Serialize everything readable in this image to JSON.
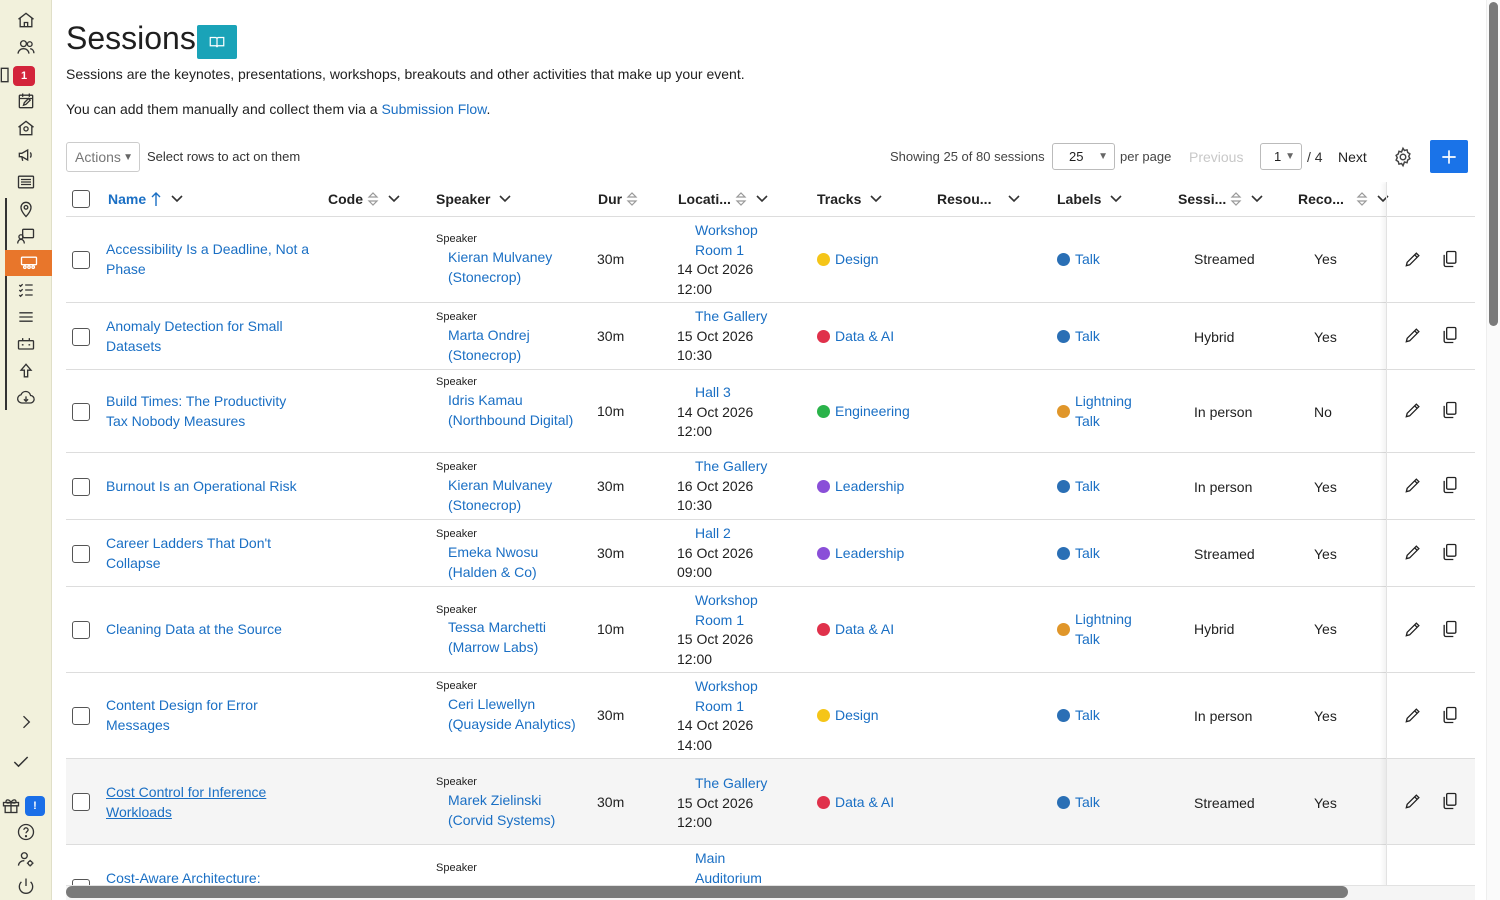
{
  "page": {
    "title": "Sessions",
    "description": "Sessions are the keynotes, presentations, workshops, breakouts and other activities that make up your event.",
    "add_text": "You can add them manually and collect them via a ",
    "add_link": "Submission Flow",
    "add_suffix": "."
  },
  "sidebar": {
    "badge_notifications": "1",
    "badge_updates": "!"
  },
  "toolbar": {
    "actions_label": "Actions",
    "select_hint": "Select rows to act on them",
    "showing": "Showing 25 of 80 sessions",
    "per_page_value": "25",
    "per_page_label": "per page",
    "previous": "Previous",
    "page_value": "1",
    "page_total": "/ 4",
    "next": "Next"
  },
  "columns": {
    "name": "Name",
    "code": "Code",
    "speaker": "Speaker",
    "duration": "Dur",
    "location": "Locati...",
    "tracks": "Tracks",
    "resources": "Resou...",
    "labels": "Labels",
    "session_type": "Sessi...",
    "recorded": "Reco..."
  },
  "colors": {
    "accent": "#1a6fc4",
    "sidebar_active": "#e8762b",
    "design": "#f5c518",
    "data_ai": "#e0314b",
    "engineering": "#2ab34a",
    "leadership": "#8a4fd8",
    "talk": "#2a6fb5",
    "lightning": "#e0962a"
  },
  "rows": [
    {
      "name": "Accessibility Is a Deadline, Not a Phase",
      "speaker_label": "Speaker",
      "speaker": "Kieran Mulvaney (Stonecrop)",
      "duration": "30m",
      "place": "Workshop Room 1",
      "date": "14 Oct 2026",
      "time": "12:00",
      "track": "Design",
      "label": "Talk",
      "session": "Streamed",
      "recorded": "Yes"
    },
    {
      "name": "Anomaly Detection for Small Datasets",
      "speaker_label": "Speaker",
      "speaker": "Marta Ondrej (Stonecrop)",
      "duration": "30m",
      "place": "The Gallery",
      "date": "15 Oct 2026",
      "time": "10:30",
      "track": "Data & AI",
      "label": "Talk",
      "session": "Hybrid",
      "recorded": "Yes"
    },
    {
      "name": "Build Times: The Productivity Tax Nobody Measures",
      "speaker_label": "Speaker",
      "speaker": "Idris Kamau (Northbound Digital)",
      "duration": "10m",
      "place": "Hall 3",
      "date": "14 Oct 2026",
      "time": "12:00",
      "track": "Engineering",
      "label": "Lightning Talk",
      "session": "In person",
      "recorded": "No"
    },
    {
      "name": "Burnout Is an Operational Risk",
      "speaker_label": "Speaker",
      "speaker": "Kieran Mulvaney (Stonecrop)",
      "duration": "30m",
      "place": "The Gallery",
      "date": "16 Oct 2026",
      "time": "10:30",
      "track": "Leadership",
      "label": "Talk",
      "session": "In person",
      "recorded": "Yes"
    },
    {
      "name": "Career Ladders That Don't Collapse",
      "speaker_label": "Speaker",
      "speaker": "Emeka Nwosu (Halden & Co)",
      "duration": "30m",
      "place": "Hall 2",
      "date": "16 Oct 2026",
      "time": "09:00",
      "track": "Leadership",
      "label": "Talk",
      "session": "Streamed",
      "recorded": "Yes"
    },
    {
      "name": "Cleaning Data at the Source",
      "speaker_label": "Speaker",
      "speaker": "Tessa Marchetti (Marrow Labs)",
      "duration": "10m",
      "place": "Workshop Room 1",
      "date": "15 Oct 2026",
      "time": "12:00",
      "track": "Data & AI",
      "label": "Lightning Talk",
      "session": "Hybrid",
      "recorded": "Yes"
    },
    {
      "name": "Content Design for Error Messages",
      "speaker_label": "Speaker",
      "speaker": "Ceri Llewellyn (Quayside Analytics)",
      "duration": "30m",
      "place": "Workshop Room 1",
      "date": "14 Oct 2026",
      "time": "14:00",
      "track": "Design",
      "label": "Talk",
      "session": "In person",
      "recorded": "Yes"
    },
    {
      "name": "Cost Control for Inference Workloads",
      "speaker_label": "Speaker",
      "speaker": "Marek Zielinski (Corvid Systems)",
      "duration": "30m",
      "place": "The Gallery",
      "date": "15 Oct 2026",
      "time": "12:00",
      "track": "Data & AI",
      "label": "Talk",
      "session": "Streamed",
      "recorded": "Yes"
    },
    {
      "name": "Cost-Aware Architecture:",
      "speaker_label": "Speaker",
      "speaker": "",
      "duration": "",
      "place": "Main Auditorium",
      "date": "",
      "time": "",
      "track": "",
      "label": "",
      "session": "",
      "recorded": ""
    }
  ]
}
